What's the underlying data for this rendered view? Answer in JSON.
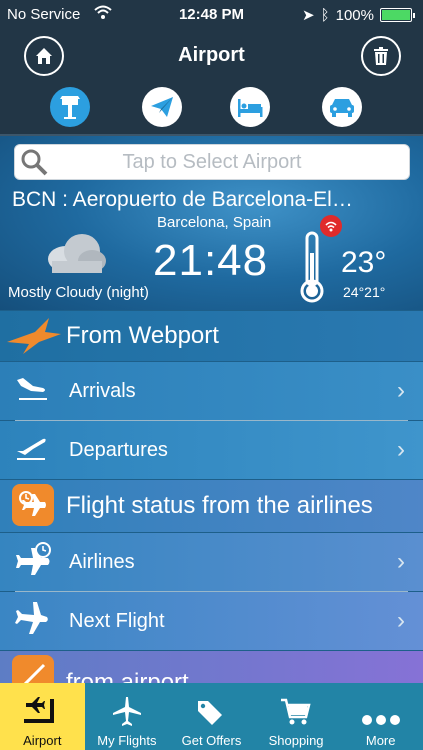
{
  "status": {
    "carrier": "No Service",
    "time": "12:48 PM",
    "battery": "100%"
  },
  "nav": {
    "title": "Airport",
    "left_icon": "home-icon",
    "right_icon": "trash-icon"
  },
  "top_tabs": [
    "control-tower-icon",
    "paper-plane-icon",
    "hotel-bed-icon",
    "car-icon"
  ],
  "search": {
    "placeholder": "Tap to Select Airport"
  },
  "airport": {
    "name": "BCN : Aeropuerto de Barcelona-El…",
    "city": "Barcelona, Spain",
    "time": "21:48",
    "temp": "23°",
    "temp_range": "24°21°",
    "condition": "Mostly Cloudy (night)"
  },
  "sections": {
    "webport": {
      "title": "From Webport",
      "items": [
        "Arrivals",
        "Departures"
      ]
    },
    "airlines": {
      "title": "Flight status from the airlines",
      "items": [
        "Airlines",
        "Next Flight"
      ]
    },
    "from_airport": {
      "title": "from airport"
    }
  },
  "tabbar": [
    {
      "label": "Airport",
      "icon": "airport-icon"
    },
    {
      "label": "My Flights",
      "icon": "plane-icon"
    },
    {
      "label": "Get Offers",
      "icon": "tags-icon"
    },
    {
      "label": "Shopping",
      "icon": "cart-icon"
    },
    {
      "label": "More",
      "icon": "more-icon"
    }
  ],
  "colors": {
    "accent": "#2c9fe0",
    "orange": "#f08a2c",
    "tabbar": "#2284a6",
    "active_tab": "#ffe14c"
  }
}
